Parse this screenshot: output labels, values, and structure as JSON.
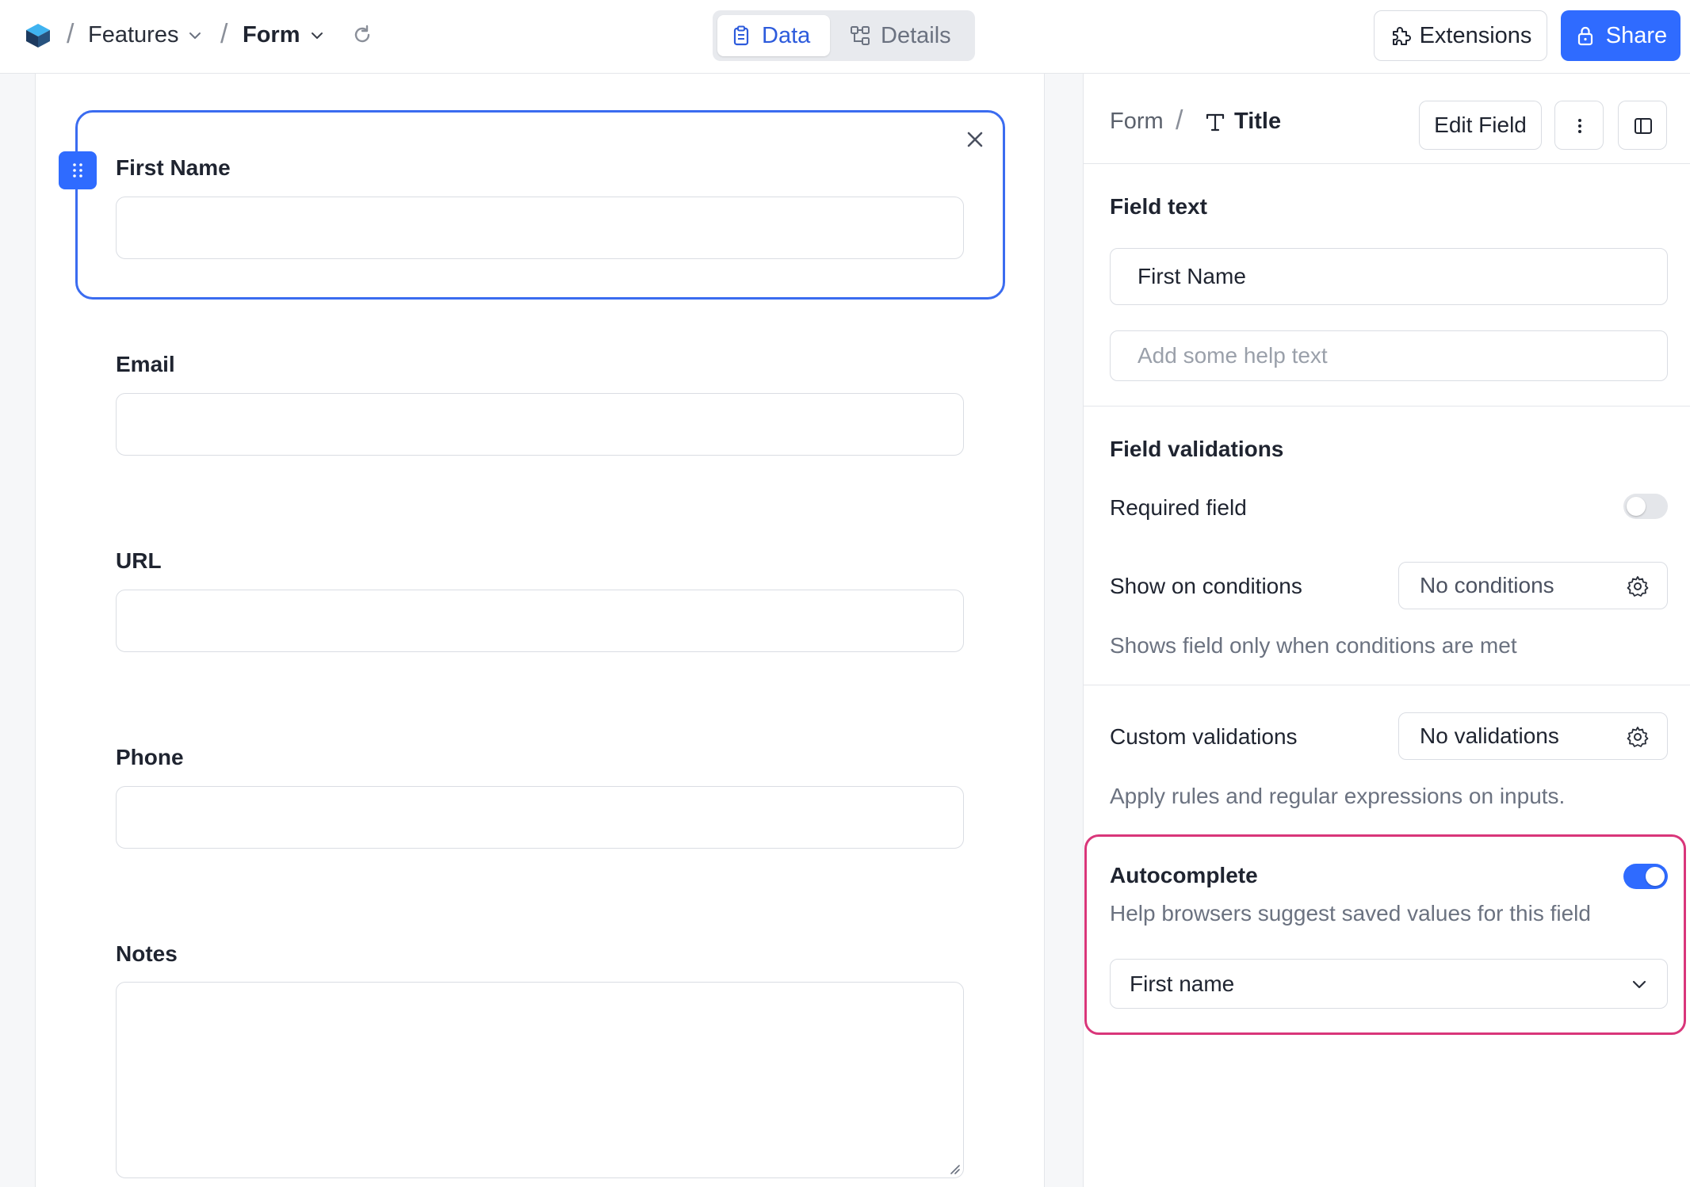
{
  "header": {
    "breadcrumb": [
      {
        "label": "Features",
        "has_dropdown": true
      },
      {
        "label": "Form",
        "has_dropdown": true,
        "current": true
      }
    ],
    "separator": "/",
    "view_tabs": [
      {
        "label": "Data",
        "icon": "clipboard-icon",
        "active": true
      },
      {
        "label": "Details",
        "icon": "diagram-icon",
        "active": false
      }
    ],
    "extensions_label": "Extensions",
    "share_label": "Share"
  },
  "form": {
    "fields": [
      {
        "label": "First Name",
        "type": "text",
        "selected": true
      },
      {
        "label": "Email",
        "type": "text"
      },
      {
        "label": "URL",
        "type": "text"
      },
      {
        "label": "Phone",
        "type": "text"
      },
      {
        "label": "Notes",
        "type": "textarea"
      }
    ]
  },
  "panel": {
    "breadcrumb_root": "Form",
    "breadcrumb_separator": "/",
    "field_type": "Title",
    "edit_button": "Edit Field",
    "field_text": {
      "title": "Field text",
      "value": "First Name",
      "help_placeholder": "Add some help text"
    },
    "validations": {
      "title": "Field validations",
      "required_label": "Required field",
      "required_on": false,
      "show_on_label": "Show on conditions",
      "show_on_value": "No conditions",
      "show_on_helper": "Shows field only when conditions are met"
    },
    "custom_validations": {
      "label": "Custom validations",
      "value": "No validations",
      "helper": "Apply rules and regular expressions on inputs."
    },
    "autocomplete": {
      "title": "Autocomplete",
      "enabled": true,
      "helper": "Help browsers suggest saved values for this field",
      "selected": "First name"
    }
  },
  "colors": {
    "accent": "#2f6bff",
    "selection_border": "#3b6cf0",
    "highlight": "#d9367a"
  }
}
